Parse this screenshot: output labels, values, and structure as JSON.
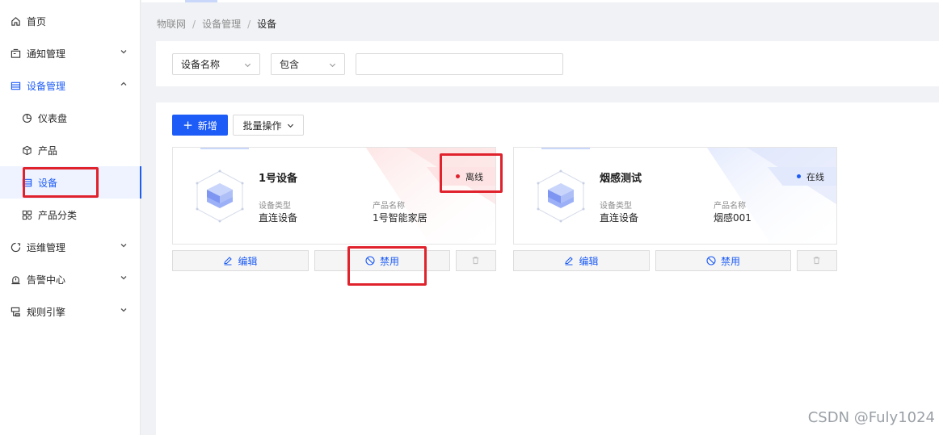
{
  "sidebar": {
    "items": [
      {
        "label": "首页",
        "icon": "home-icon"
      },
      {
        "label": "通知管理",
        "icon": "notification-icon"
      },
      {
        "label": "设备管理",
        "icon": "device-manage-icon"
      },
      {
        "label": "仪表盘",
        "icon": "dashboard-icon"
      },
      {
        "label": "产品",
        "icon": "product-cube-icon"
      },
      {
        "label": "设备",
        "icon": "device-list-icon"
      },
      {
        "label": "产品分类",
        "icon": "category-icon"
      },
      {
        "label": "运维管理",
        "icon": "ops-icon"
      },
      {
        "label": "告警中心",
        "icon": "alarm-icon"
      },
      {
        "label": "规则引擎",
        "icon": "rule-engine-icon"
      }
    ]
  },
  "breadcrumb": {
    "items": [
      "物联网",
      "设备管理",
      "设备"
    ],
    "separator": "/"
  },
  "filter": {
    "field_select": "设备名称",
    "operator_select": "包含",
    "value": "",
    "placeholder": ""
  },
  "toolbar": {
    "add_label": "新增",
    "add_icon": "+",
    "batch_label": "批量操作"
  },
  "cards": [
    {
      "name": "1号设备",
      "status": "离线",
      "status_type": "offline",
      "type_label": "设备类型",
      "type_value": "直连设备",
      "product_label": "产品名称",
      "product_value": "1号智能家居"
    },
    {
      "name": "烟感测试",
      "status": "在线",
      "status_type": "online",
      "type_label": "设备类型",
      "type_value": "直连设备",
      "product_label": "产品名称",
      "product_value": "烟感001"
    }
  ],
  "actions": {
    "edit_label": "编辑",
    "disable_label": "禁用"
  },
  "colors": {
    "primary": "#1d5cf6",
    "offline": "#e0222d",
    "annotation": "#e0222d"
  },
  "watermark": "CSDN @Fuly1024"
}
